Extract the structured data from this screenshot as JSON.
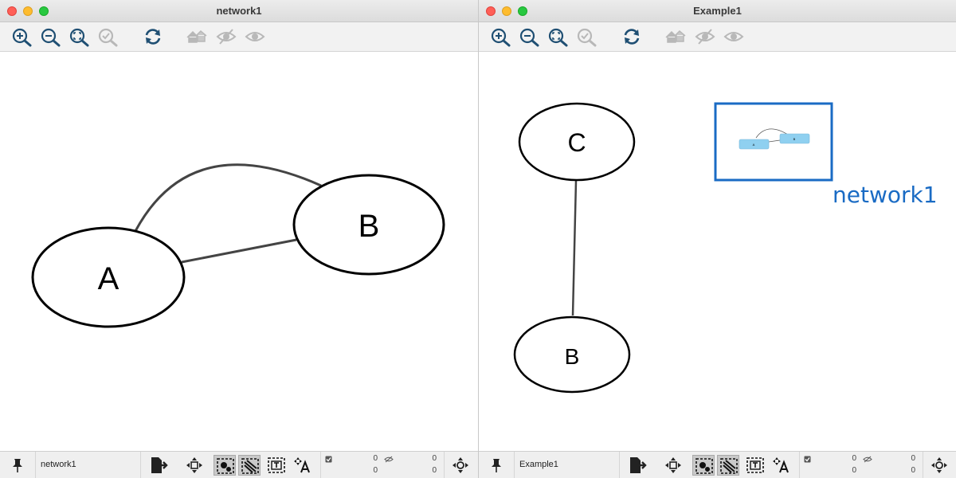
{
  "left_window": {
    "title": "network1",
    "status_name": "network1",
    "counts": {
      "selected_nodes": "0",
      "selected_edges": "0",
      "hidden_nodes": "0",
      "hidden_edges": "0"
    },
    "nodes": [
      {
        "label": "A"
      },
      {
        "label": "B"
      }
    ]
  },
  "right_window": {
    "title": "Example1",
    "status_name": "Example1",
    "counts": {
      "selected_nodes": "0",
      "selected_edges": "0",
      "hidden_nodes": "0",
      "hidden_edges": "0"
    },
    "nodes": [
      {
        "label": "C"
      },
      {
        "label": "B"
      }
    ],
    "nested_network_label": "network1",
    "nested_network_color": "#1a6bc4"
  },
  "toolbar_icons": [
    "zoom-in-icon",
    "zoom-out-icon",
    "zoom-fit-icon",
    "zoom-selected-icon",
    "refresh-icon",
    "home-icon",
    "hide-icon",
    "show-icon"
  ],
  "statusbar_icons": [
    "pin-icon",
    "export-icon",
    "pan-icon",
    "select-nodes-icon",
    "select-edges-icon",
    "select-annotations-icon",
    "label-move-icon",
    "navigate-icon"
  ],
  "colors": {
    "accent": "#1a6bc4",
    "icon_active": "#1f4f73",
    "icon_disabled": "#b8b8b8"
  }
}
